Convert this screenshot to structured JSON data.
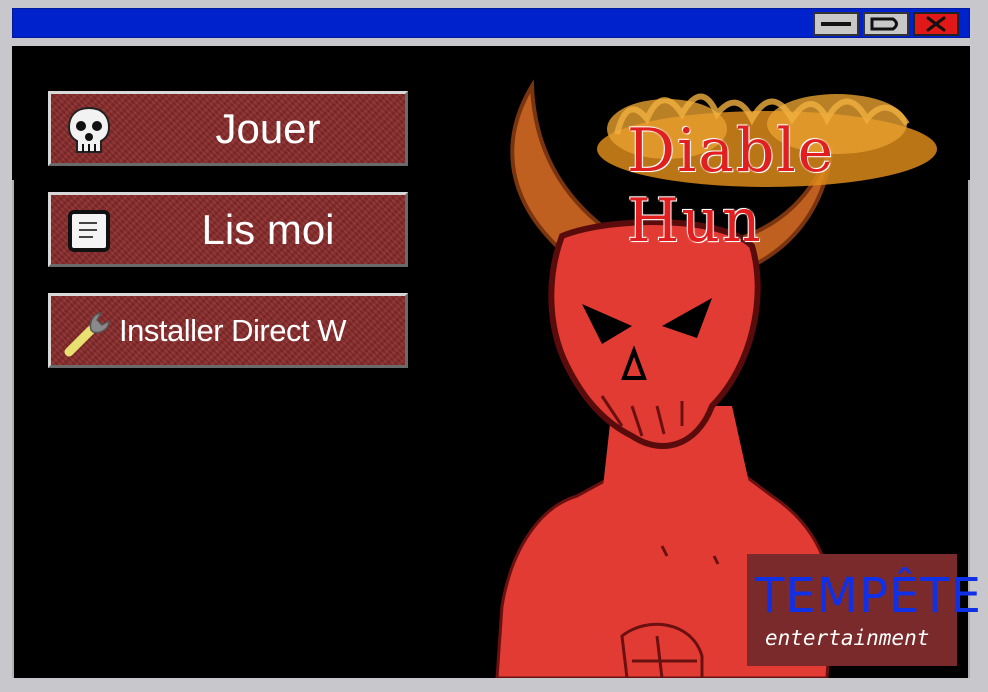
{
  "window": {
    "controls": {
      "minimize_icon": "minimize-icon",
      "maximize_icon": "maximize-icon",
      "close_icon": "close-icon"
    },
    "titlebar_color": "#0022cc"
  },
  "menu": {
    "play_label": "Jouer",
    "readme_label": "Lis moi",
    "install_label": "Installer Direct W"
  },
  "game": {
    "title": "Diable Hun"
  },
  "studio": {
    "name": "TEMPÊTE",
    "tagline": "entertainment"
  },
  "colors": {
    "button_bg": "#8a2b2b",
    "devil_red": "#e23b33",
    "studio_bg": "#7a2a2a",
    "studio_text": "#1030e8"
  }
}
